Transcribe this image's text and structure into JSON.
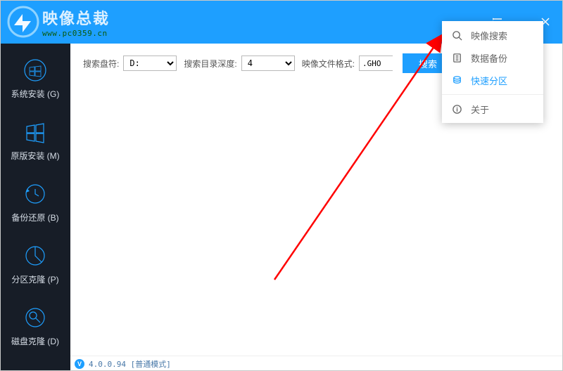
{
  "brand": {
    "title": "映像总裁",
    "url": "www.pc0359.cn"
  },
  "sidebar": {
    "items": [
      {
        "label": "系统安装 (G)"
      },
      {
        "label": "原版安装 (M)"
      },
      {
        "label": "备份还原 (B)"
      },
      {
        "label": "分区克隆 (P)"
      },
      {
        "label": "磁盘克隆 (D)"
      }
    ]
  },
  "toolbar": {
    "drive_label": "搜索盘符:",
    "drive_value": "D:",
    "depth_label": "搜索目录深度:",
    "depth_value": "4",
    "format_label": "映像文件格式:",
    "format_value": ".GHO",
    "search_button": "搜索"
  },
  "menu": {
    "items": [
      {
        "label": "映像搜索"
      },
      {
        "label": "数据备份"
      },
      {
        "label": "快速分区"
      },
      {
        "label": "关于"
      }
    ]
  },
  "status": {
    "badge": "V",
    "text": "4.0.0.94 [普通模式]"
  }
}
